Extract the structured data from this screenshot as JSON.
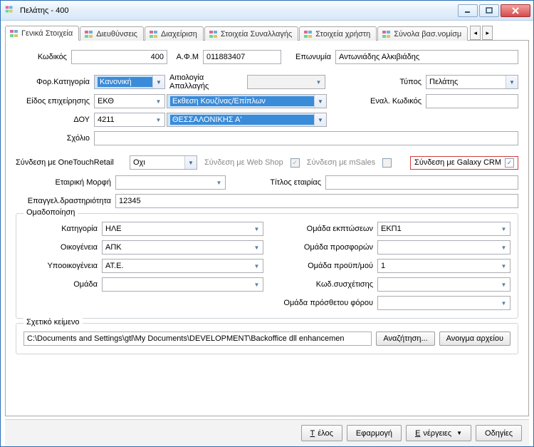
{
  "window": {
    "title": "Πελάτης - 400"
  },
  "tabs": {
    "items": [
      {
        "label": "Γενικά Στοιχεία"
      },
      {
        "label": "Διευθύνσεις"
      },
      {
        "label": "Διαχείριση"
      },
      {
        "label": "Στοιχεία Συναλλαγής"
      },
      {
        "label": "Στοιχεία χρήστη"
      },
      {
        "label": "Σύνολα βασ.νομίσμ"
      }
    ]
  },
  "general": {
    "code_label": "Κωδικός",
    "code_value": "400",
    "vat_label": "Α.Φ.Μ",
    "vat_value": "011883407",
    "name_label": "Επωνυμία",
    "name_value": "Αντωνιάδης Αλκιβιάδης",
    "taxcat_label": "Φορ.Κατηγορία",
    "taxcat_value": "Κανονική",
    "exempt_label": "Αιτιολογία Απαλλαγής",
    "exempt_value": "",
    "type_label": "Τύπος",
    "type_value": "Πελάτης",
    "bustype_label": "Είδος επιχείρησης",
    "bustype_value": "ΕΚΘ",
    "bustype_desc": "Εκθεση Κουζίνας/Επίπλων",
    "doy_label": "ΔΟΥ",
    "doy_value": "4211",
    "doy_desc": "ΘΕΣΣΑΛΟΝΙΚΗΣ Α'",
    "altcode_label": "Εναλ. Κωδικός",
    "altcode_value": "",
    "comment_label": "Σχόλιο",
    "comment_value": ""
  },
  "links": {
    "otr_label": "Σύνδεση με OneTouchRetail",
    "otr_value": "Οχι",
    "webshop_label": "Σύνδεση με Web Shop",
    "msales_label": "Σύνδεση με mSales",
    "galaxy_label": "Σύνδεση με Galaxy CRM"
  },
  "company": {
    "form_label": "Εταιρική Μορφή",
    "form_value": "",
    "title_label": "Τίτλος εταιρίας",
    "title_value": "",
    "activity_label": "Επαγγελ.δραστηριότητα",
    "activity_value": "12345"
  },
  "grouping": {
    "legend": "Ομαδοποίηση",
    "category_label": "Κατηγορία",
    "category_value": "ΗΛΕ",
    "family_label": "Οικογένεια",
    "family_value": "ΑΠΚ",
    "subfamily_label": "Υποοικογένεια",
    "subfamily_value": "ΑΤ.Ε.",
    "group_label": "Ομάδα",
    "group_value": "",
    "discgrp_label": "Ομάδα εκπτώσεων",
    "discgrp_value": "ΕΚΠ1",
    "offergrp_label": "Ομάδα προσφορών",
    "offergrp_value": "",
    "budgetgrp_label": "Ομάδα προϋπ/μού",
    "budgetgrp_value": "1",
    "corrcode_label": "Κωδ.συσχέτισης",
    "corrcode_value": "",
    "addtaxgrp_label": "Ομάδα πρόσθετου φόρου",
    "addtaxgrp_value": ""
  },
  "reltext": {
    "legend": "Σχετικό κείμενο",
    "path": "C:\\Documents and Settings\\gtl\\My Documents\\DEVELOPMENT\\Backoffice dll enhancemen",
    "browse": "Αναζήτηση...",
    "open": "Ανοιγμα αρχείου"
  },
  "footer": {
    "close": "Τέλος",
    "apply": "Εφαρμογή",
    "actions": "Ενέργειες",
    "help": "Οδηγίες"
  }
}
